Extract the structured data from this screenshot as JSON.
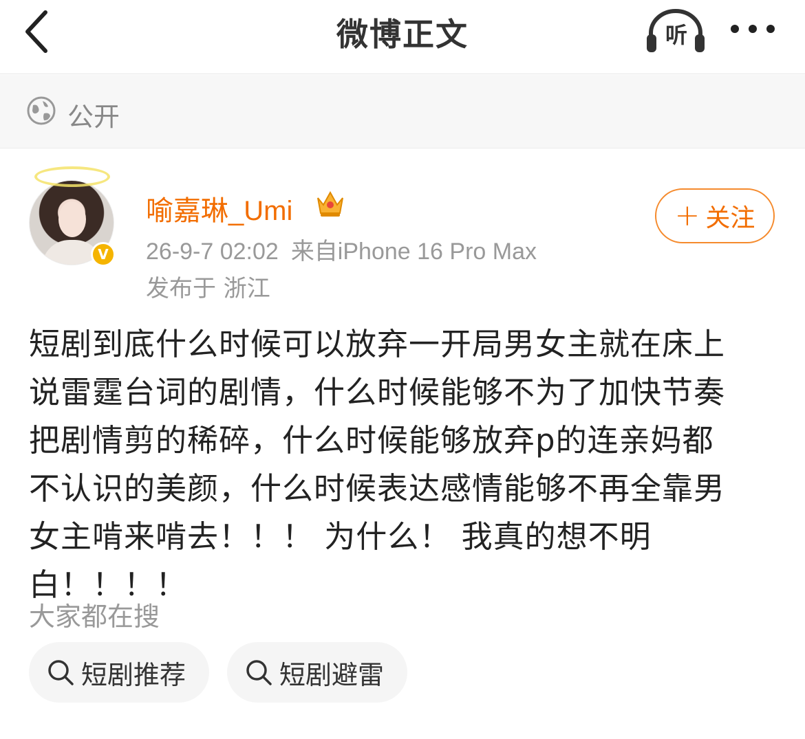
{
  "header": {
    "title": "微博正文",
    "listen_label": "听"
  },
  "visibility": {
    "label": "公开"
  },
  "author": {
    "name": "喻嘉琳_Umi",
    "timestamp": "26-9-7 02:02",
    "source": "来自iPhone 16 Pro Max",
    "location": "发布于 浙江",
    "follow_label": "关注"
  },
  "post": {
    "lines": [
      "短剧到底什么时候可以放弃一开局男女主就在床上",
      "说雷霆台词的剧情，什么时候能够不为了加快节奏",
      "把剧情剪的稀碎，什么时候能够放弃p的连亲妈都",
      "不认识的美颜，什么时候表达感情能够不再全靠男",
      "女主啃来啃去！！！ 为什么！ 我真的想不明白！！！！"
    ]
  },
  "search": {
    "title": "大家都在搜",
    "chips": [
      "短剧推荐",
      "短剧避雷"
    ]
  },
  "colors": {
    "accent": "#f26d00",
    "muted": "#999999",
    "verified": "#f5b400"
  }
}
